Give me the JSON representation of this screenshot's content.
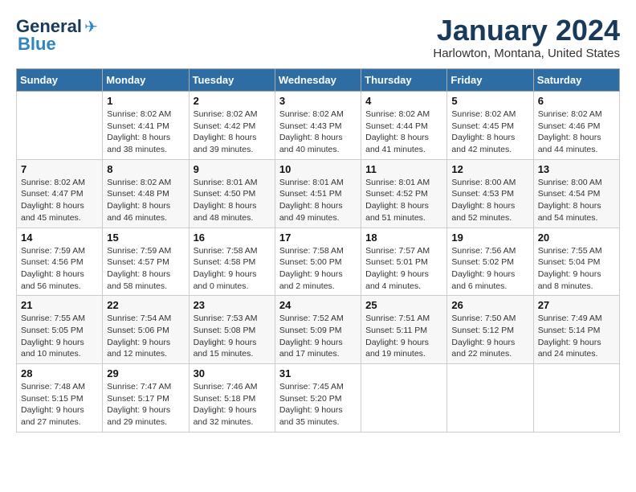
{
  "header": {
    "logo_line1": "General",
    "logo_line2": "Blue",
    "month": "January 2024",
    "location": "Harlowton, Montana, United States"
  },
  "weekdays": [
    "Sunday",
    "Monday",
    "Tuesday",
    "Wednesday",
    "Thursday",
    "Friday",
    "Saturday"
  ],
  "weeks": [
    [
      {
        "day": "",
        "sunrise": "",
        "sunset": "",
        "daylight": ""
      },
      {
        "day": "1",
        "sunrise": "Sunrise: 8:02 AM",
        "sunset": "Sunset: 4:41 PM",
        "daylight": "Daylight: 8 hours and 38 minutes."
      },
      {
        "day": "2",
        "sunrise": "Sunrise: 8:02 AM",
        "sunset": "Sunset: 4:42 PM",
        "daylight": "Daylight: 8 hours and 39 minutes."
      },
      {
        "day": "3",
        "sunrise": "Sunrise: 8:02 AM",
        "sunset": "Sunset: 4:43 PM",
        "daylight": "Daylight: 8 hours and 40 minutes."
      },
      {
        "day": "4",
        "sunrise": "Sunrise: 8:02 AM",
        "sunset": "Sunset: 4:44 PM",
        "daylight": "Daylight: 8 hours and 41 minutes."
      },
      {
        "day": "5",
        "sunrise": "Sunrise: 8:02 AM",
        "sunset": "Sunset: 4:45 PM",
        "daylight": "Daylight: 8 hours and 42 minutes."
      },
      {
        "day": "6",
        "sunrise": "Sunrise: 8:02 AM",
        "sunset": "Sunset: 4:46 PM",
        "daylight": "Daylight: 8 hours and 44 minutes."
      }
    ],
    [
      {
        "day": "7",
        "sunrise": "Sunrise: 8:02 AM",
        "sunset": "Sunset: 4:47 PM",
        "daylight": "Daylight: 8 hours and 45 minutes."
      },
      {
        "day": "8",
        "sunrise": "Sunrise: 8:02 AM",
        "sunset": "Sunset: 4:48 PM",
        "daylight": "Daylight: 8 hours and 46 minutes."
      },
      {
        "day": "9",
        "sunrise": "Sunrise: 8:01 AM",
        "sunset": "Sunset: 4:50 PM",
        "daylight": "Daylight: 8 hours and 48 minutes."
      },
      {
        "day": "10",
        "sunrise": "Sunrise: 8:01 AM",
        "sunset": "Sunset: 4:51 PM",
        "daylight": "Daylight: 8 hours and 49 minutes."
      },
      {
        "day": "11",
        "sunrise": "Sunrise: 8:01 AM",
        "sunset": "Sunset: 4:52 PM",
        "daylight": "Daylight: 8 hours and 51 minutes."
      },
      {
        "day": "12",
        "sunrise": "Sunrise: 8:00 AM",
        "sunset": "Sunset: 4:53 PM",
        "daylight": "Daylight: 8 hours and 52 minutes."
      },
      {
        "day": "13",
        "sunrise": "Sunrise: 8:00 AM",
        "sunset": "Sunset: 4:54 PM",
        "daylight": "Daylight: 8 hours and 54 minutes."
      }
    ],
    [
      {
        "day": "14",
        "sunrise": "Sunrise: 7:59 AM",
        "sunset": "Sunset: 4:56 PM",
        "daylight": "Daylight: 8 hours and 56 minutes."
      },
      {
        "day": "15",
        "sunrise": "Sunrise: 7:59 AM",
        "sunset": "Sunset: 4:57 PM",
        "daylight": "Daylight: 8 hours and 58 minutes."
      },
      {
        "day": "16",
        "sunrise": "Sunrise: 7:58 AM",
        "sunset": "Sunset: 4:58 PM",
        "daylight": "Daylight: 9 hours and 0 minutes."
      },
      {
        "day": "17",
        "sunrise": "Sunrise: 7:58 AM",
        "sunset": "Sunset: 5:00 PM",
        "daylight": "Daylight: 9 hours and 2 minutes."
      },
      {
        "day": "18",
        "sunrise": "Sunrise: 7:57 AM",
        "sunset": "Sunset: 5:01 PM",
        "daylight": "Daylight: 9 hours and 4 minutes."
      },
      {
        "day": "19",
        "sunrise": "Sunrise: 7:56 AM",
        "sunset": "Sunset: 5:02 PM",
        "daylight": "Daylight: 9 hours and 6 minutes."
      },
      {
        "day": "20",
        "sunrise": "Sunrise: 7:55 AM",
        "sunset": "Sunset: 5:04 PM",
        "daylight": "Daylight: 9 hours and 8 minutes."
      }
    ],
    [
      {
        "day": "21",
        "sunrise": "Sunrise: 7:55 AM",
        "sunset": "Sunset: 5:05 PM",
        "daylight": "Daylight: 9 hours and 10 minutes."
      },
      {
        "day": "22",
        "sunrise": "Sunrise: 7:54 AM",
        "sunset": "Sunset: 5:06 PM",
        "daylight": "Daylight: 9 hours and 12 minutes."
      },
      {
        "day": "23",
        "sunrise": "Sunrise: 7:53 AM",
        "sunset": "Sunset: 5:08 PM",
        "daylight": "Daylight: 9 hours and 15 minutes."
      },
      {
        "day": "24",
        "sunrise": "Sunrise: 7:52 AM",
        "sunset": "Sunset: 5:09 PM",
        "daylight": "Daylight: 9 hours and 17 minutes."
      },
      {
        "day": "25",
        "sunrise": "Sunrise: 7:51 AM",
        "sunset": "Sunset: 5:11 PM",
        "daylight": "Daylight: 9 hours and 19 minutes."
      },
      {
        "day": "26",
        "sunrise": "Sunrise: 7:50 AM",
        "sunset": "Sunset: 5:12 PM",
        "daylight": "Daylight: 9 hours and 22 minutes."
      },
      {
        "day": "27",
        "sunrise": "Sunrise: 7:49 AM",
        "sunset": "Sunset: 5:14 PM",
        "daylight": "Daylight: 9 hours and 24 minutes."
      }
    ],
    [
      {
        "day": "28",
        "sunrise": "Sunrise: 7:48 AM",
        "sunset": "Sunset: 5:15 PM",
        "daylight": "Daylight: 9 hours and 27 minutes."
      },
      {
        "day": "29",
        "sunrise": "Sunrise: 7:47 AM",
        "sunset": "Sunset: 5:17 PM",
        "daylight": "Daylight: 9 hours and 29 minutes."
      },
      {
        "day": "30",
        "sunrise": "Sunrise: 7:46 AM",
        "sunset": "Sunset: 5:18 PM",
        "daylight": "Daylight: 9 hours and 32 minutes."
      },
      {
        "day": "31",
        "sunrise": "Sunrise: 7:45 AM",
        "sunset": "Sunset: 5:20 PM",
        "daylight": "Daylight: 9 hours and 35 minutes."
      },
      {
        "day": "",
        "sunrise": "",
        "sunset": "",
        "daylight": ""
      },
      {
        "day": "",
        "sunrise": "",
        "sunset": "",
        "daylight": ""
      },
      {
        "day": "",
        "sunrise": "",
        "sunset": "",
        "daylight": ""
      }
    ]
  ]
}
